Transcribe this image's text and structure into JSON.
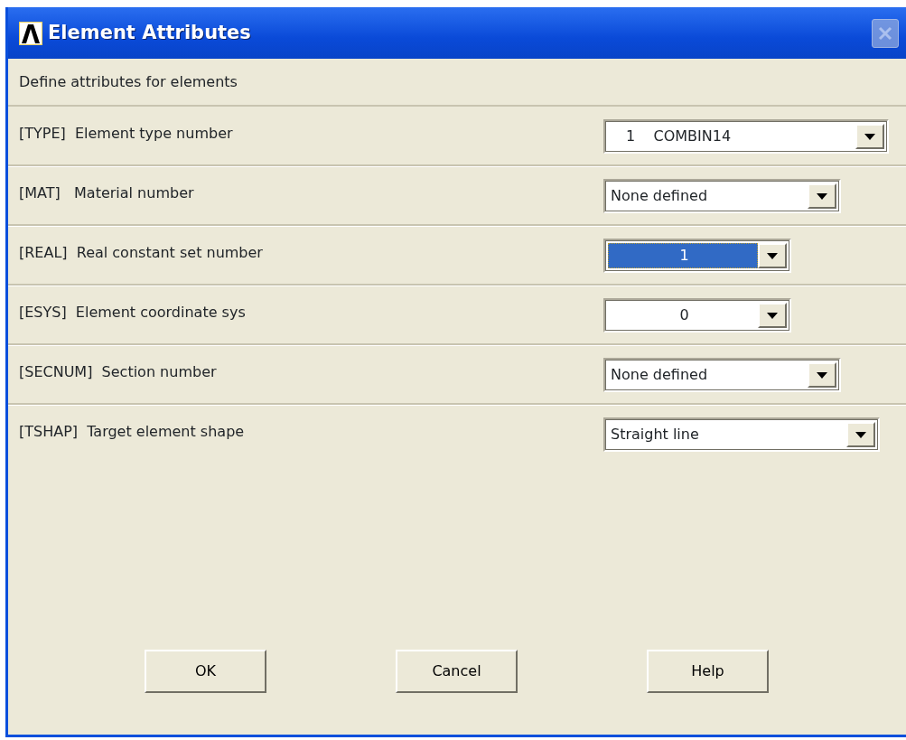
{
  "window": {
    "title": "Element Attributes",
    "close_disabled": true
  },
  "description": "Define attributes for elements",
  "fields": [
    {
      "label": "[TYPE]  Element type number",
      "value": "1    COMBIN14",
      "selected": false
    },
    {
      "label": "[MAT]   Material number",
      "value": "None defined",
      "selected": false
    },
    {
      "label": "[REAL]  Real constant set number",
      "value": "1",
      "selected": true
    },
    {
      "label": "[ESYS]  Element coordinate sys",
      "value": "0",
      "selected": false
    },
    {
      "label": "[SECNUM]  Section number",
      "value": "None defined",
      "selected": false
    },
    {
      "label": "[TSHAP]  Target element shape",
      "value": "Straight line",
      "selected": false
    }
  ],
  "buttons": [
    "OK",
    "Cancel",
    "Help"
  ]
}
